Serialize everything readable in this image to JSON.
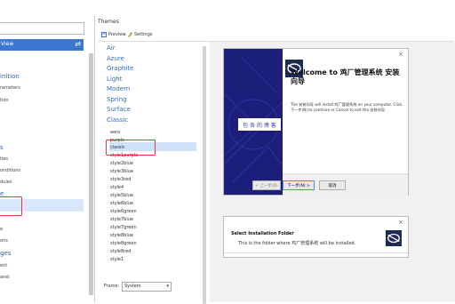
{
  "left": {
    "view_label": "View",
    "headings": [
      "inition",
      "s",
      "e",
      "ges"
    ],
    "items": [
      "rameters",
      "tion",
      "ites",
      "onditions",
      "dules",
      "e",
      "ons",
      "ent",
      "anel"
    ]
  },
  "themes": {
    "title": "Themes",
    "tabs": {
      "preview": "Preview",
      "settings": "Settings"
    },
    "categories": [
      "Air",
      "Azure",
      "Graphite",
      "Light",
      "Modern",
      "Spring",
      "Surface",
      "Classic"
    ],
    "items": [
      "aero",
      "purple",
      "classic",
      "style1purple",
      "style2blue",
      "style3blue",
      "style3red",
      "style4",
      "style5blue",
      "style6blue",
      "style6green",
      "style7blue",
      "style7green",
      "style8blue",
      "style8green",
      "style8red",
      "style1"
    ],
    "selected": "classic",
    "frame_label": "Frame:",
    "frame_value": "System"
  },
  "wizard1": {
    "title": "Welcome to 鸡厂管理系统 安装向导",
    "body": "The 安装向导 will install 鸡厂管理系统 on your computer. Click 下一步(N) to continue or Cancel to exit the 安装向导.",
    "badge": "包 各 的 博 客",
    "back": "< 上一步(B)",
    "next": "下一步(N) >",
    "cancel": "取消",
    "close": "×"
  },
  "wizard2": {
    "title": "Select Installation Folder",
    "desc": "This is the folder where 鸡厂管理系统 will be installed.",
    "close": "×"
  },
  "colors": {
    "accent": "#3c78d0",
    "wizard_side": "#1b1f7a",
    "highlight_red": "#e23a3a"
  }
}
